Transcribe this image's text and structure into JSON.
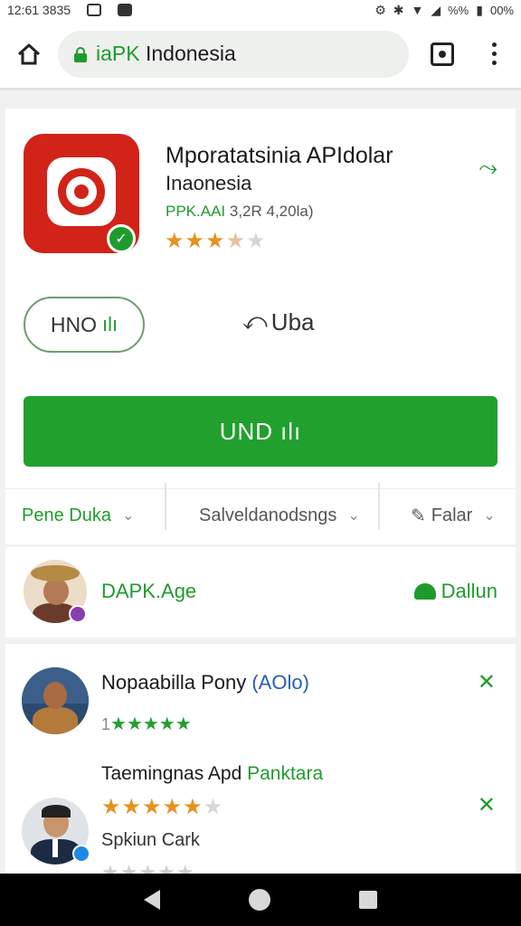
{
  "status_bar": {
    "time": "12:61 3835",
    "battery": "00%",
    "signal": "%%"
  },
  "browser": {
    "url_prefix": "iaPK",
    "url_rest": " Indonesia"
  },
  "app": {
    "title": "Mporatatsinia APIdolar",
    "subtitle": "Inaonesia",
    "meta_prefix": "PPK.AAI",
    "meta_rest": " 3,2R 4,20la)",
    "rating_stars": 3.5,
    "outline_button_label": "HNO",
    "share_label": "Uba",
    "install_label": "UND",
    "options": [
      "Pene Duka",
      "Salveldanodsngs",
      "Falar"
    ]
  },
  "developer": {
    "name": "DAPK.Age",
    "action_label": "Dallun"
  },
  "reviews": [
    {
      "name": "Nopaabilla Pony",
      "name_extra": " (AOlo)",
      "rating_number": "1",
      "stars": 5
    },
    {
      "title_prefix": "Taemingnas Apd ",
      "title_green": "Panktara",
      "stars": 5,
      "stars_on": 4,
      "name": "Spkiun Cark"
    }
  ],
  "colors": {
    "accent_green": "#1f9b2d",
    "install_green": "#21a02d",
    "app_icon_red": "#d22318",
    "star_orange": "#e8911f"
  },
  "icons": {
    "home": "home-icon",
    "lock": "lock-icon",
    "tabs": "tabs-icon",
    "menu": "overflow-menu-icon",
    "share": "share-icon",
    "install": "bar-chart-icon",
    "developer": "android-icon",
    "review_action": "expand-icon"
  }
}
